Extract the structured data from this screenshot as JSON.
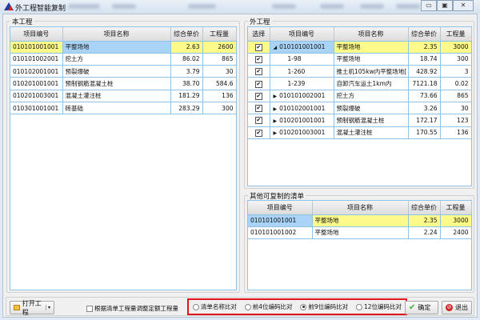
{
  "window": {
    "title": "外工程智能复制",
    "minimize": "▭",
    "maximize": "▣",
    "close": "✕"
  },
  "local": {
    "label": "本工程",
    "headers": [
      "项目编号",
      "项目名称",
      "综合单价",
      "工程量"
    ],
    "rows": [
      [
        "010101001001",
        "平整场地",
        "2.63",
        "2600"
      ],
      [
        "010101002001",
        "挖土方",
        "86.02",
        "865"
      ],
      [
        "010102001001",
        "预裂爆破",
        "3.79",
        "30"
      ],
      [
        "010201001001",
        "预制钢筋混凝土桩",
        "38.70",
        "584.6"
      ],
      [
        "010201003001",
        "混凝土灌注桩",
        "181.29",
        "136"
      ],
      [
        "010301001001",
        "砖基础",
        "283.29",
        "300"
      ]
    ]
  },
  "external": {
    "label": "外工程",
    "headers": [
      "选择",
      "项目编号",
      "项目名称",
      "综合单价",
      "工程量"
    ],
    "rows": [
      {
        "checked": true,
        "expander": "◢",
        "code": "010101001001",
        "name": "平整场地",
        "price": "2.35",
        "qty": "3000"
      },
      {
        "checked": true,
        "expander": "",
        "code": "1-98",
        "name": "平整场地",
        "price": "18.74",
        "qty": "300"
      },
      {
        "checked": true,
        "expander": "",
        "code": "1-260",
        "name": "推土机105kw内平整场地[",
        "price": "428.92",
        "qty": "3"
      },
      {
        "checked": true,
        "expander": "",
        "code": "1-239",
        "name": "自卸汽车运土1km内",
        "price": "7121.18",
        "qty": "0.02"
      },
      {
        "checked": true,
        "expander": "▶",
        "code": "010101002001",
        "name": "挖土方",
        "price": "73.66",
        "qty": "865"
      },
      {
        "checked": true,
        "expander": "▶",
        "code": "010102001001",
        "name": "预裂爆破",
        "price": "3.26",
        "qty": "30"
      },
      {
        "checked": true,
        "expander": "▶",
        "code": "010201001001",
        "name": "预制钢筋混凝土桩",
        "price": "172.17",
        "qty": "123"
      },
      {
        "checked": true,
        "expander": "▶",
        "code": "010201003001",
        "name": "混凝土灌注桩",
        "price": "170.55",
        "qty": "136"
      }
    ]
  },
  "other": {
    "label": "其他可复制的清单",
    "headers": [
      "项目编号",
      "项目名称",
      "综合单价",
      "工程量"
    ],
    "rows": [
      [
        "010101001001",
        "平整场地",
        "2.35",
        "3000"
      ],
      [
        "010101001002",
        "平整场地",
        "2.24",
        "2400"
      ]
    ]
  },
  "footer": {
    "open_project": "打开工程",
    "adjust_checkbox": "根据清单工程量调整定额工程量",
    "radios": [
      {
        "label": "清单名称比对",
        "selected": false
      },
      {
        "label": "前4位编码比对",
        "selected": false
      },
      {
        "label": "前9位编码比对",
        "selected": true
      },
      {
        "label": "12位编码比对",
        "selected": false
      }
    ],
    "ok": "确定",
    "exit": "退出",
    "highlight_color": "#e0161e"
  }
}
